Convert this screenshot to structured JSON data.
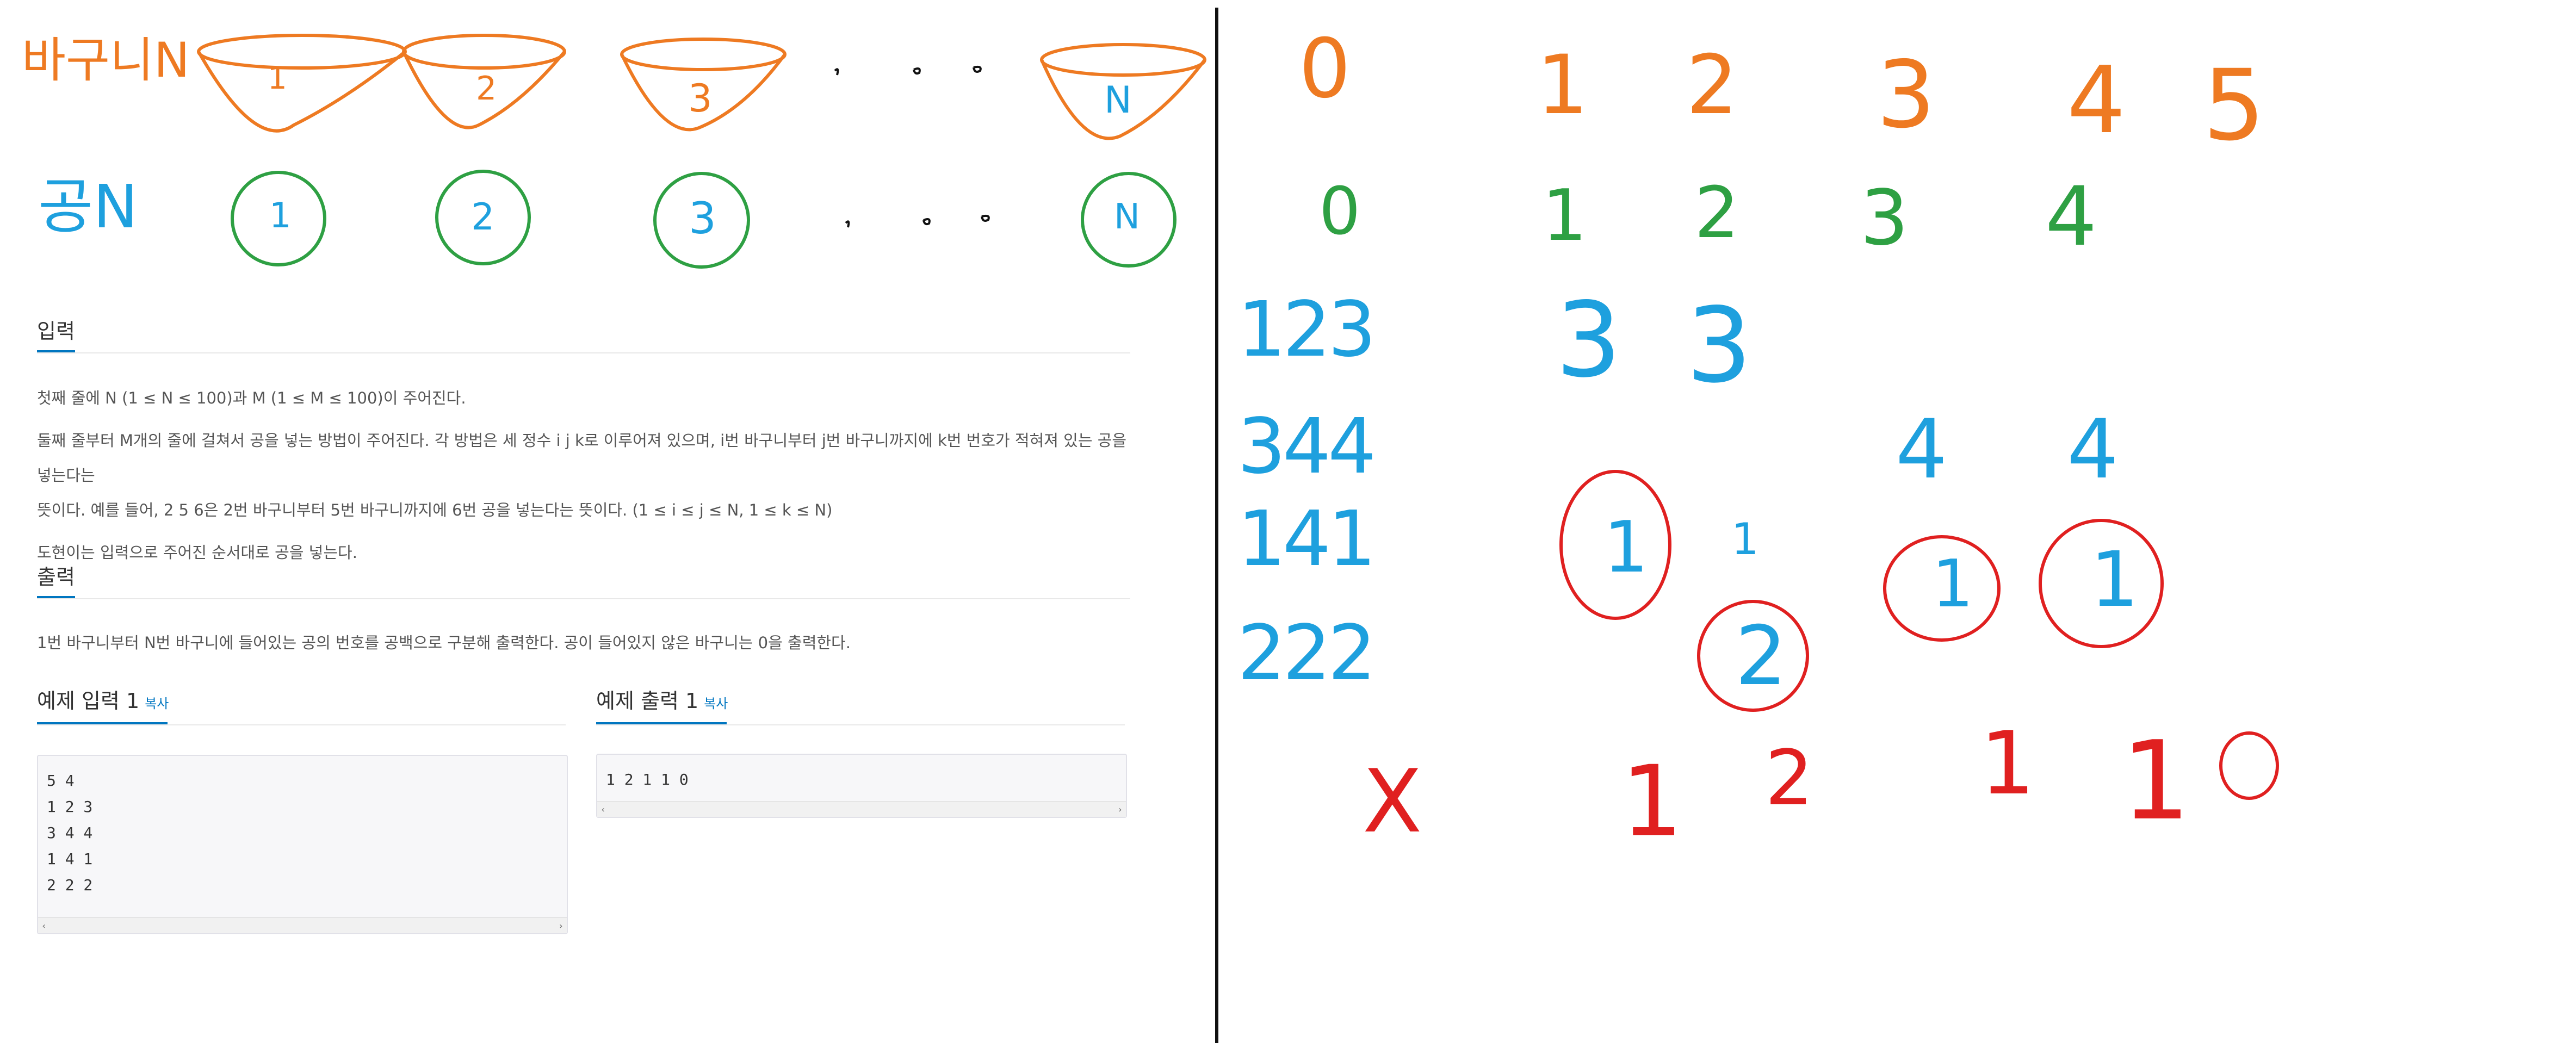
{
  "diagram": {
    "baskets_label": "바구니N",
    "balls_label": "공N",
    "basket_numbers": [
      "1",
      "2",
      "3",
      "N"
    ],
    "ball_numbers": [
      "1",
      "2",
      "3",
      "N"
    ],
    "ellipsis": "...",
    "basket_color": "#ee7a22",
    "ball_color": "#2ea043"
  },
  "input_section": {
    "title": "입력",
    "lines": [
      "첫째 줄에 N (1 ≤ N ≤ 100)과 M (1 ≤ M ≤ 100)이 주어진다.",
      "둘째 줄부터 M개의 줄에 걸쳐서 공을 넣는 방법이 주어진다. 각 방법은 세 정수 i j k로 이루어져 있으며, i번 바구니부터 j번 바구니까지에 k번 번호가 적혀져 있는 공을 넣는다는",
      "뜻이다. 예를 들어, 2 5 6은 2번 바구니부터 5번 바구니까지에 6번 공을 넣는다는 뜻이다. (1 ≤ i ≤ j ≤ N, 1 ≤ k ≤ N)",
      "도현이는 입력으로 주어진 순서대로 공을 넣는다."
    ]
  },
  "output_section": {
    "title": "출력",
    "lines": [
      "1번 바구니부터 N번 바구니에 들어있는 공의 번호를 공백으로 구분해 출력한다. 공이 들어있지 않은 바구니는 0을 출력한다."
    ]
  },
  "sample_input": {
    "title": "예제 입력 1",
    "copy_label": "복사",
    "content": "5 4\n1 2 3\n3 4 4\n1 4 1\n2 2 2"
  },
  "sample_output": {
    "title": "예제 출력 1",
    "copy_label": "복사",
    "content": "1 2 1 1 0"
  },
  "scratch": {
    "index_row_orange": [
      "0",
      "1",
      "2",
      "3",
      "4",
      "5"
    ],
    "index_row_green": [
      "0",
      "1",
      "2",
      "3",
      "4"
    ],
    "ops": [
      "123",
      "344",
      "141",
      "222"
    ],
    "row1": [
      "3",
      "3"
    ],
    "row2": [
      "4",
      "4"
    ],
    "row3_circled": [
      "1",
      "1",
      "1"
    ],
    "row3_small": "1",
    "row4_circled": "2",
    "result": [
      "X",
      "1",
      "2",
      "1",
      "1",
      "0"
    ],
    "colors": {
      "orange": "#ee7a22",
      "green": "#2ea043",
      "blue": "#1ea0de",
      "red": "#e02020"
    }
  }
}
